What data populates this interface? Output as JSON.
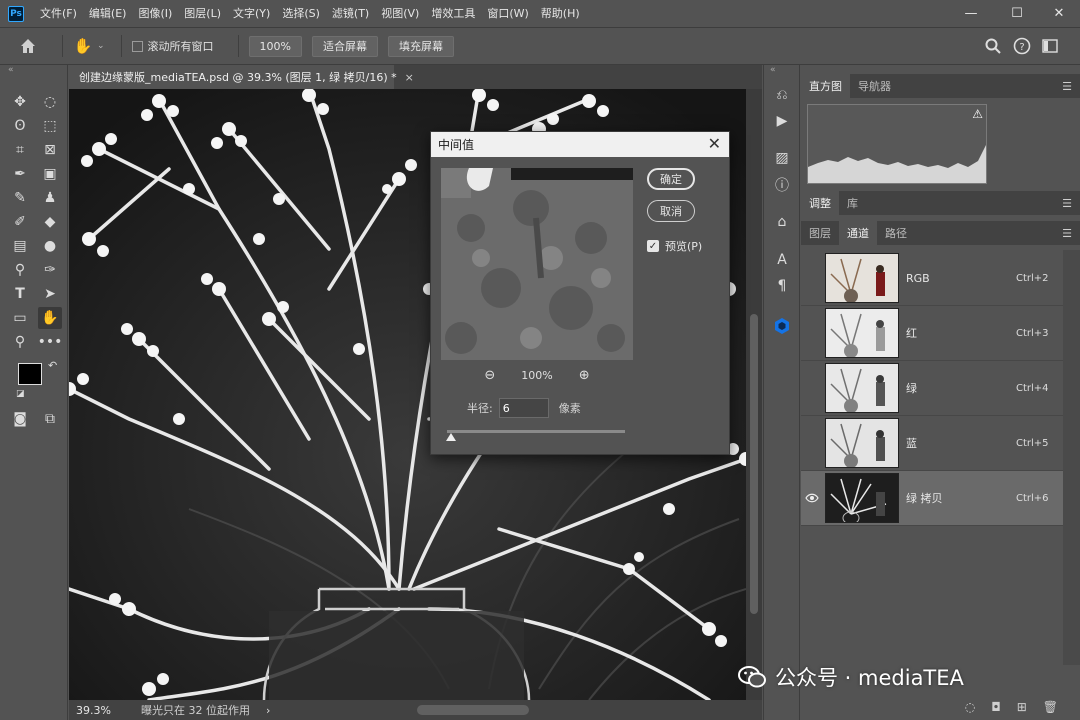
{
  "app": {
    "logo_text": "Ps"
  },
  "menu": [
    "文件(F)",
    "编辑(E)",
    "图像(I)",
    "图层(L)",
    "文字(Y)",
    "选择(S)",
    "滤镜(T)",
    "视图(V)",
    "增效工具",
    "窗口(W)",
    "帮助(H)"
  ],
  "window_controls": {
    "minimize": "—",
    "restore": "☐",
    "close": "✕"
  },
  "options": {
    "scroll_all_label": "滚动所有窗口",
    "zoom_100": "100%",
    "fit_screen": "适合屏幕",
    "fill_screen": "填充屏幕"
  },
  "document": {
    "tab_title": "创建边缘蒙版_mediaTEA.psd @ 39.3% (图层 1, 绿 拷贝/16) *",
    "tab_close": "×"
  },
  "status": {
    "zoom": "39.3%",
    "text": "曝光只在 32 位起作用",
    "arrow": "›"
  },
  "dialog": {
    "title": "中间值",
    "close": "✕",
    "ok_label": "确定",
    "cancel_label": "取消",
    "preview_label": "预览(P)",
    "preview_checked": true,
    "zoom_level": "100%",
    "radius_label": "半径:",
    "radius_value": "6",
    "radius_unit": "像素",
    "radius_slider_fraction": 0.02
  },
  "panels": {
    "top_tabs": [
      "直方图",
      "导航器"
    ],
    "mid_tabs": [
      "调整",
      "库"
    ],
    "channel_tabs": [
      "图层",
      "通道",
      "路径"
    ],
    "histogram_warning": "⚠",
    "channels": [
      {
        "name": "RGB",
        "shortcut": "Ctrl+2",
        "visible": false,
        "active": false
      },
      {
        "name": "红",
        "shortcut": "Ctrl+3",
        "visible": false,
        "active": false
      },
      {
        "name": "绿",
        "shortcut": "Ctrl+4",
        "visible": false,
        "active": false
      },
      {
        "name": "蓝",
        "shortcut": "Ctrl+5",
        "visible": false,
        "active": false
      },
      {
        "name": "绿 拷贝",
        "shortcut": "Ctrl+6",
        "visible": true,
        "active": true
      }
    ]
  },
  "watermark": {
    "text": "公众号 · mediaTEA"
  },
  "colors": {
    "ui_bg": "#535353",
    "panel_dark": "#424242",
    "dialog_title_bg": "#f0f0f0",
    "accent_ps": "#31a8ff"
  }
}
